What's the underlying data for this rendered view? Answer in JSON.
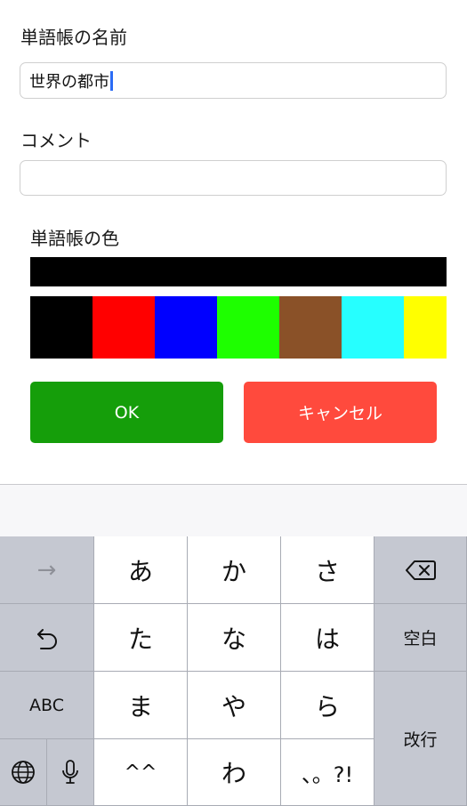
{
  "form": {
    "name_label": "単語帳の名前",
    "name_value": "世界の都市",
    "comment_label": "コメント",
    "comment_value": "",
    "color_label": "単語帳の色",
    "selected_color": "#000000",
    "swatches": [
      {
        "name": "black",
        "color": "#000000"
      },
      {
        "name": "red",
        "color": "#ff0000"
      },
      {
        "name": "blue",
        "color": "#0000ff"
      },
      {
        "name": "green",
        "color": "#1eff00"
      },
      {
        "name": "brown",
        "color": "#8a5128"
      },
      {
        "name": "cyan",
        "color": "#26ffff"
      },
      {
        "name": "yellow",
        "color": "#ffff00"
      }
    ],
    "ok_label": "OK",
    "ok_color": "#159e0a",
    "cancel_label": "キャンセル",
    "cancel_color": "#ff4a3d"
  },
  "keyboard": {
    "next_arrow": "→",
    "row1": [
      "あ",
      "か",
      "さ"
    ],
    "row2": [
      "た",
      "な",
      "は"
    ],
    "row3": [
      "ま",
      "や",
      "ら"
    ],
    "row4": [
      "^^",
      "わ",
      "、。?!"
    ],
    "abc": "ABC",
    "space": "空白",
    "return": "改行",
    "icons": [
      "delete-icon",
      "undo-icon",
      "globe-icon",
      "microphone-icon"
    ]
  }
}
